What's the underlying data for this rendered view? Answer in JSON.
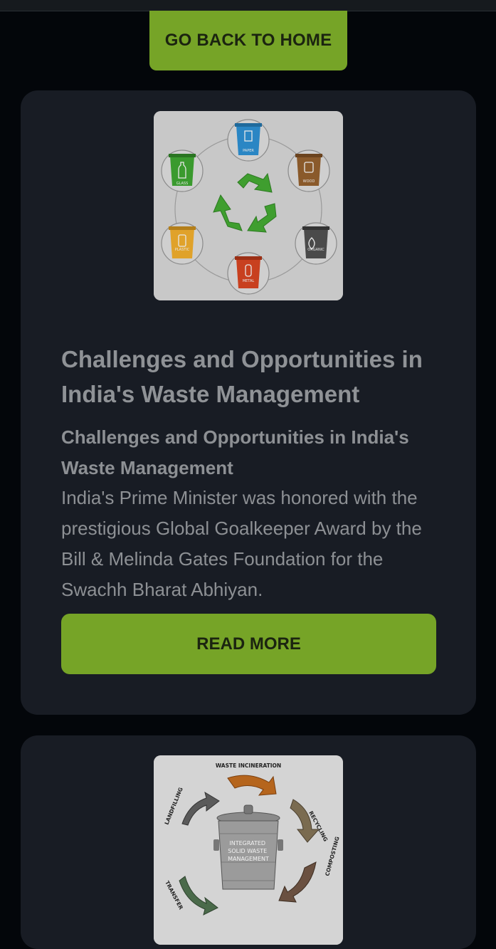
{
  "nav": {
    "home_button": "GO BACK TO HOME"
  },
  "articles": [
    {
      "image": {
        "icon": "recycle-bins-icon",
        "bins": [
          "PAPER",
          "WOOD",
          "ORGANIC",
          "METAL",
          "PLASTIC",
          "GLASS"
        ]
      },
      "title": "Challenges and Opportunities in India's Waste Management",
      "subtitle": "Challenges and Opportunities in India's Waste Management",
      "summary": "India's Prime Minister was honored with the prestigious Global Goalkeeper Award by the Bill & Melinda Gates Foundation for the Swachh Bharat Abhiyan.",
      "read_more": "READ MORE"
    },
    {
      "image": {
        "icon": "integrated-waste-management-icon",
        "labels": [
          "WASTE INCINERATION",
          "RECYCLING",
          "COMPOSTING",
          "TRANSFER",
          "LANDFILLING"
        ],
        "center_text": "INTEGRATED SOLID WASTE MANAGEMENT"
      }
    }
  ],
  "colors": {
    "background": "#03060a",
    "card": "#181c24",
    "accent": "#76a427",
    "text": "#8f9296"
  }
}
